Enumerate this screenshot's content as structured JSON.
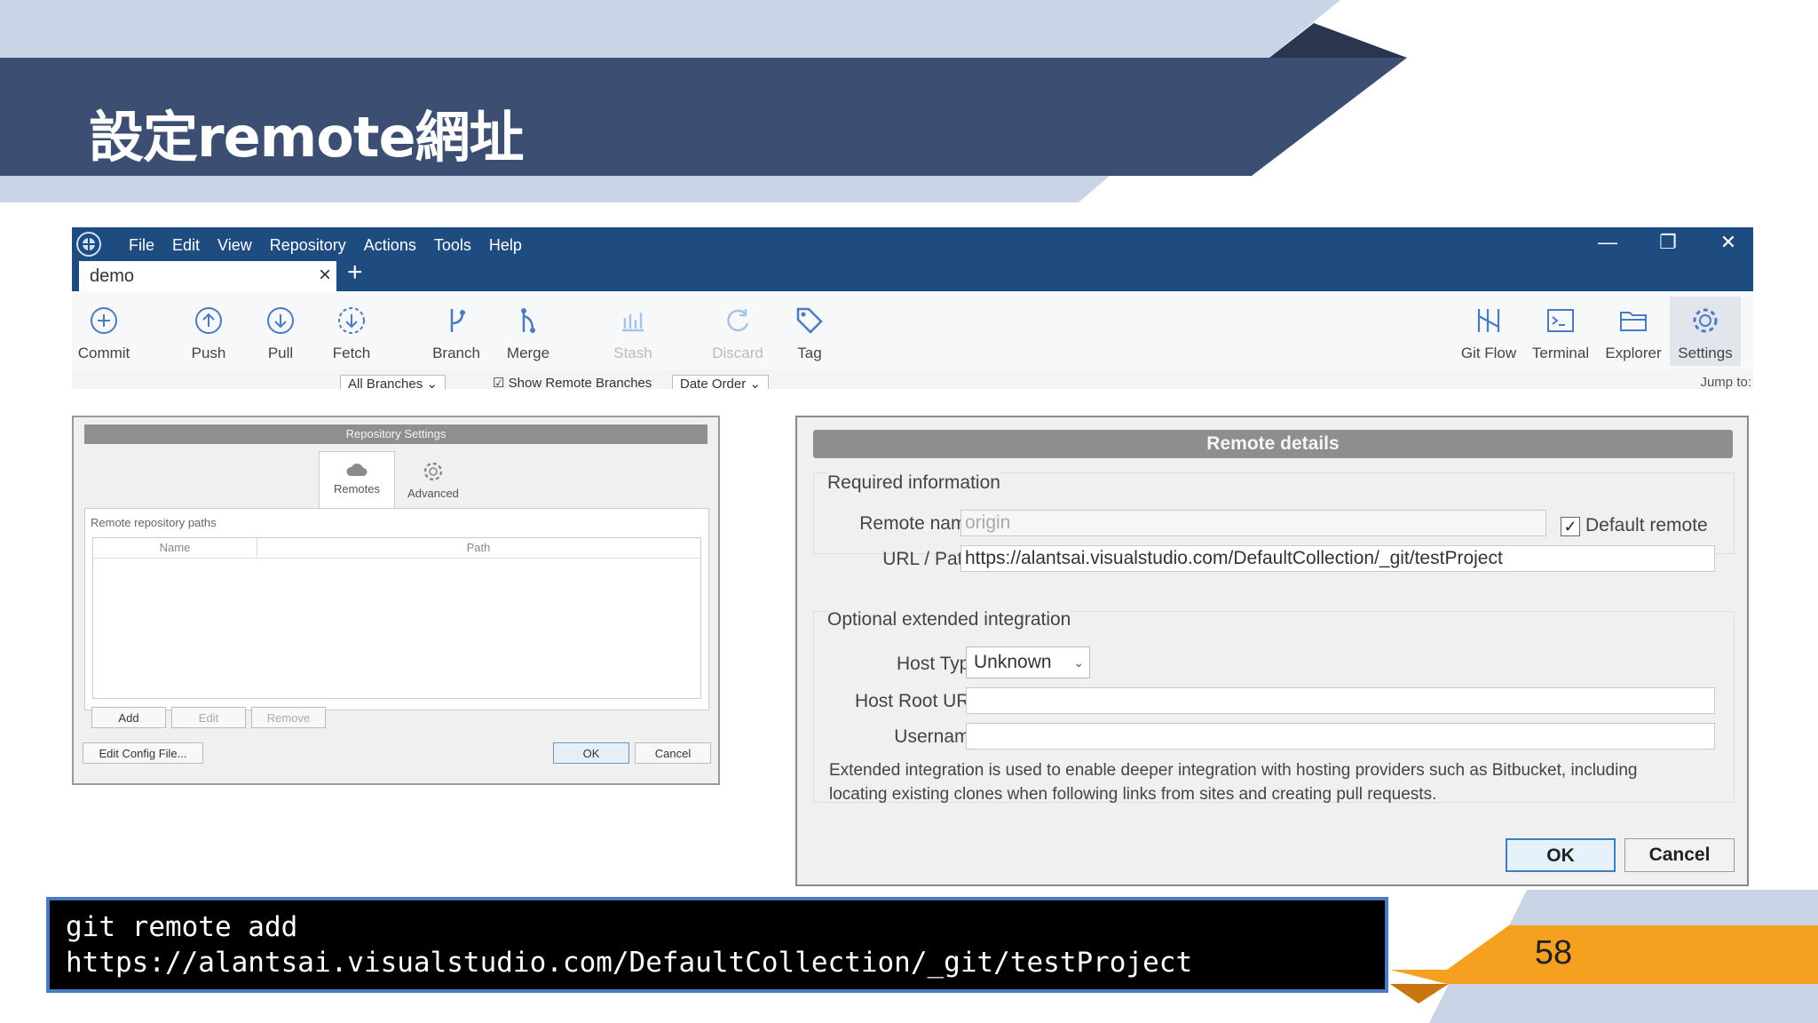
{
  "slide": {
    "title": "設定remote網址",
    "page_number": "58",
    "colors": {
      "navy": "#3c4e72",
      "light_blue": "#c9d4e6",
      "dark_navy": "#2a3550",
      "orange": "#f5a01f",
      "dark_orange": "#c8740f"
    }
  },
  "app": {
    "menu": [
      "File",
      "Edit",
      "View",
      "Repository",
      "Actions",
      "Tools",
      "Help"
    ],
    "tab_title": "demo",
    "toolbar_left": [
      {
        "label": "Commit",
        "icon": "commit-icon"
      },
      {
        "label": "Push",
        "icon": "push-icon"
      },
      {
        "label": "Pull",
        "icon": "pull-icon"
      },
      {
        "label": "Fetch",
        "icon": "fetch-icon"
      },
      {
        "label": "Branch",
        "icon": "branch-icon"
      },
      {
        "label": "Merge",
        "icon": "merge-icon"
      },
      {
        "label": "Stash",
        "icon": "stash-icon"
      },
      {
        "label": "Discard",
        "icon": "discard-icon"
      },
      {
        "label": "Tag",
        "icon": "tag-icon"
      }
    ],
    "toolbar_right": [
      {
        "label": "Git Flow",
        "icon": "git-flow-icon"
      },
      {
        "label": "Terminal",
        "icon": "terminal-icon"
      },
      {
        "label": "Explorer",
        "icon": "explorer-icon"
      },
      {
        "label": "Settings",
        "icon": "gear-icon"
      }
    ],
    "filters": {
      "branches": "All Branches",
      "show_remote": "Show Remote Branches",
      "order": "Date Order",
      "jump_to": "Jump to:"
    }
  },
  "repo_settings": {
    "title": "Repository Settings",
    "tabs": [
      "Remotes",
      "Advanced"
    ],
    "panel_title": "Remote repository paths",
    "columns": [
      "Name",
      "Path"
    ],
    "buttons": {
      "add": "Add",
      "edit": "Edit",
      "remove": "Remove",
      "edit_config": "Edit Config File...",
      "ok": "OK",
      "cancel": "Cancel"
    }
  },
  "remote_details": {
    "title": "Remote details",
    "required_label": "Required information",
    "remote_name_label": "Remote name:",
    "remote_name_value": "origin",
    "default_remote_label": "Default remote",
    "url_label": "URL / Path:",
    "url_value": "https://alantsai.visualstudio.com/DefaultCollection/_git/testProject",
    "optional_label": "Optional extended integration",
    "host_type_label": "Host Type:",
    "host_type_value": "Unknown",
    "host_root_label": "Host Root URL:",
    "username_label": "Username:",
    "description_line1": "Extended integration is used to enable deeper integration with hosting providers such as Bitbucket, including",
    "description_line2": "locating existing clones when following links from sites and creating pull requests.",
    "ok": "OK",
    "cancel": "Cancel"
  },
  "code": {
    "line1": "git remote add",
    "line2": "https://alantsai.visualstudio.com/DefaultCollection/_git/testProject"
  }
}
